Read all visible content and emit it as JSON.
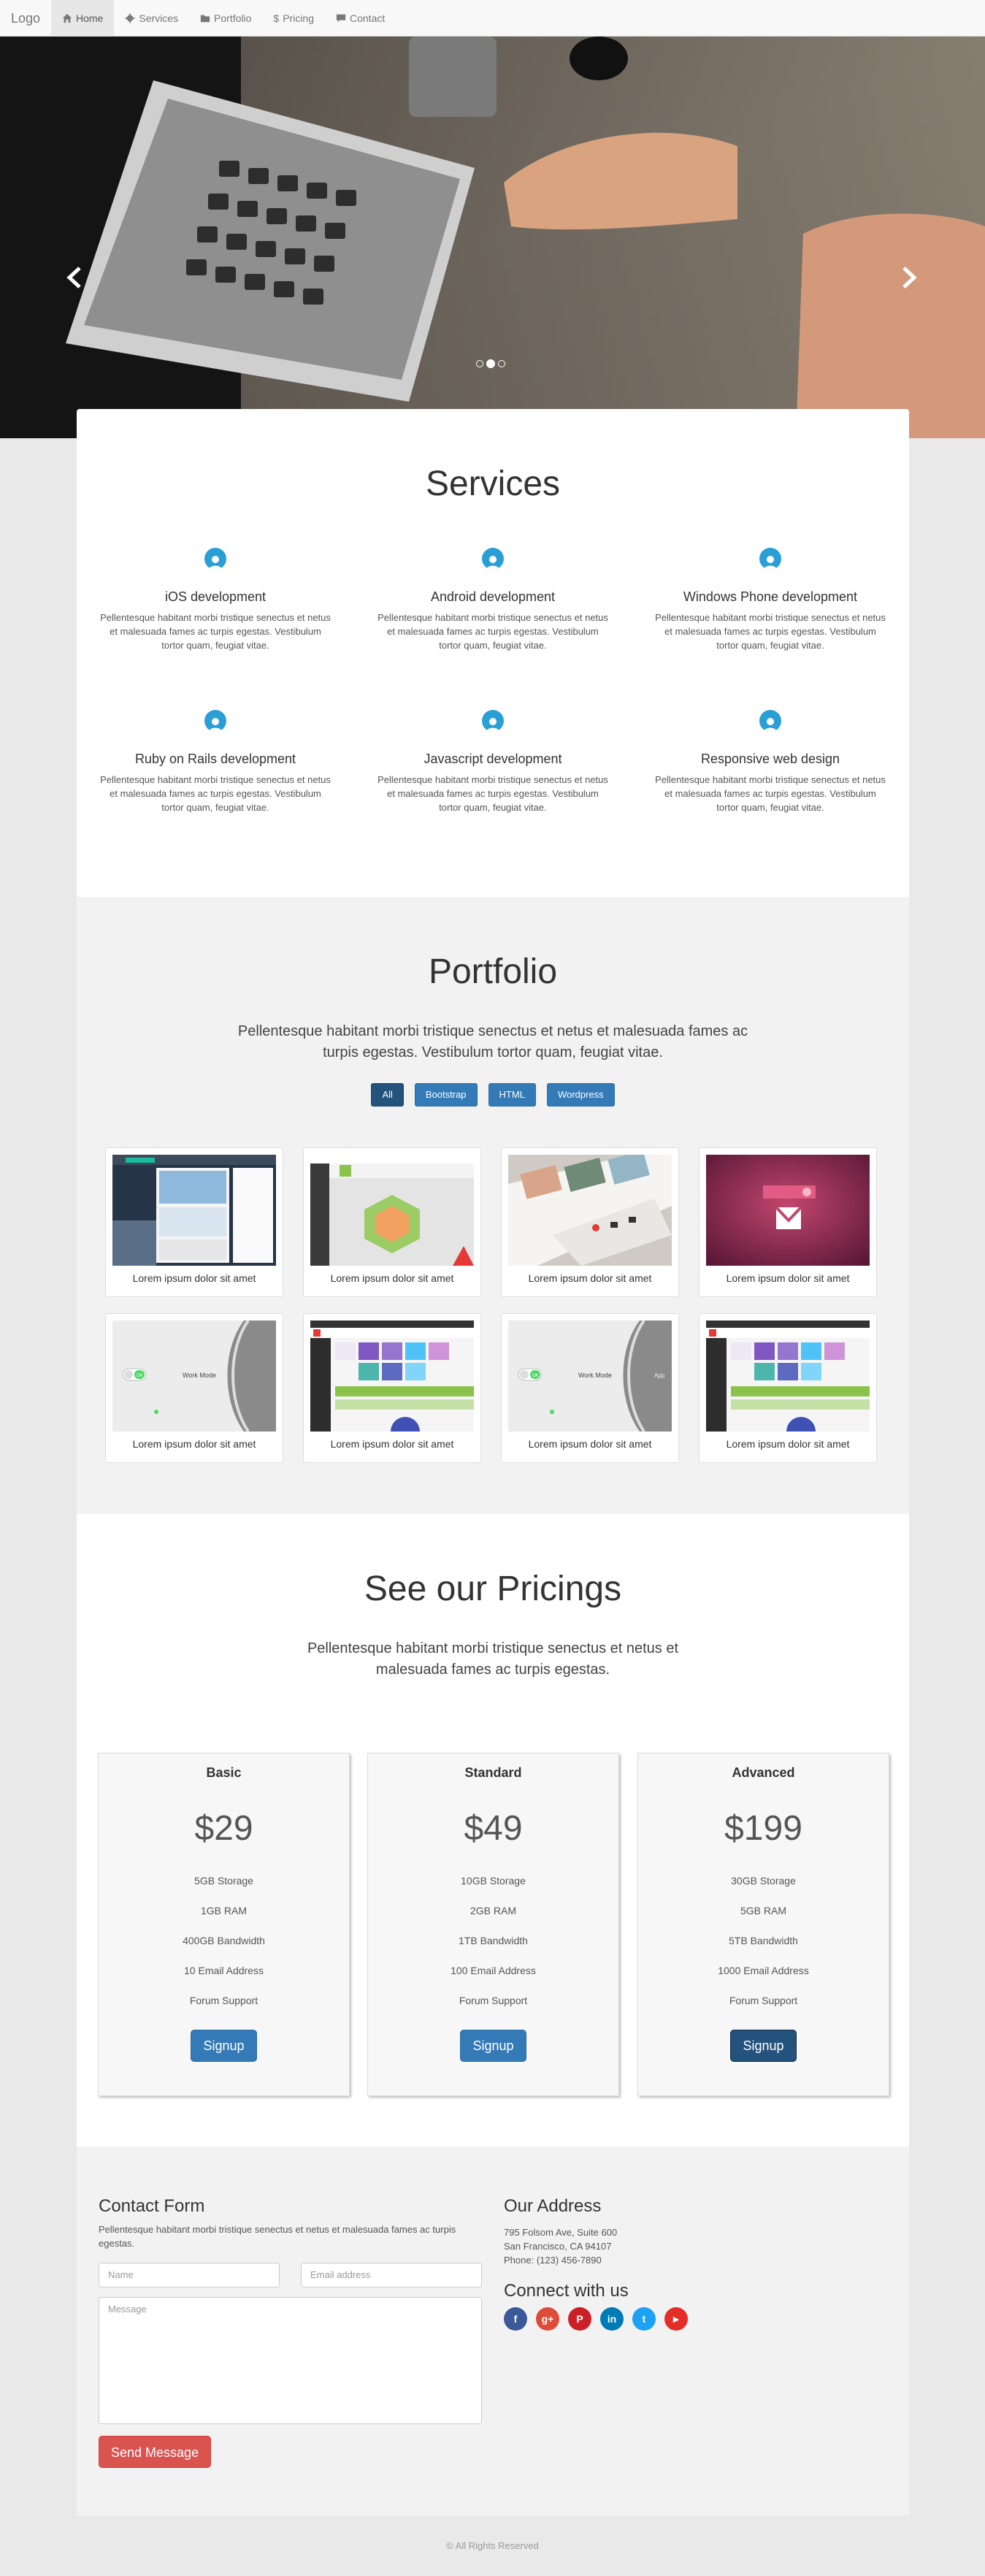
{
  "nav": {
    "logo": "Logo",
    "items": [
      {
        "label": "Home",
        "icon": "home-icon",
        "active": true
      },
      {
        "label": "Services",
        "icon": "gear-icon"
      },
      {
        "label": "Portfolio",
        "icon": "folder-icon"
      },
      {
        "label": "Pricing",
        "icon": "dollar-icon"
      },
      {
        "label": "Contact",
        "icon": "comment-icon"
      }
    ]
  },
  "carousel": {
    "slides": 3,
    "active_slide": 1
  },
  "services": {
    "title": "Services",
    "items": [
      {
        "title": "iOS development",
        "text": "Pellentesque habitant morbi tristique senectus et netus et malesuada fames ac turpis egestas. Vestibulum tortor quam, feugiat vitae."
      },
      {
        "title": "Android development",
        "text": "Pellentesque habitant morbi tristique senectus et netus et malesuada fames ac turpis egestas. Vestibulum tortor quam, feugiat vitae."
      },
      {
        "title": "Windows Phone development",
        "text": "Pellentesque habitant morbi tristique senectus et netus et malesuada fames ac turpis egestas. Vestibulum tortor quam, feugiat vitae."
      },
      {
        "title": "Ruby on Rails development",
        "text": "Pellentesque habitant morbi tristique senectus et netus et malesuada fames ac turpis egestas. Vestibulum tortor quam, feugiat vitae."
      },
      {
        "title": "Javascript development",
        "text": "Pellentesque habitant morbi tristique senectus et netus et malesuada fames ac turpis egestas. Vestibulum tortor quam, feugiat vitae."
      },
      {
        "title": "Responsive web design",
        "text": "Pellentesque habitant morbi tristique senectus et netus et malesuada fames ac turpis egestas. Vestibulum tortor quam, feugiat vitae."
      }
    ]
  },
  "portfolio": {
    "title": "Portfolio",
    "lead": "Pellentesque habitant morbi tristique senectus et netus et malesuada fames ac turpis egestas. Vestibulum tortor quam, feugiat vitae.",
    "filters": [
      "All",
      "Bootstrap",
      "HTML",
      "Wordpress"
    ],
    "active_filter": "All",
    "items": [
      {
        "caption": "Lorem ipsum dolor sit amet"
      },
      {
        "caption": "Lorem ipsum dolor sit amet"
      },
      {
        "caption": "Lorem ipsum dolor sit amet"
      },
      {
        "caption": "Lorem ipsum dolor sit amet"
      },
      {
        "caption": "Lorem ipsum dolor sit amet"
      },
      {
        "caption": "Lorem ipsum dolor sit amet"
      },
      {
        "caption": "Lorem ipsum dolor sit amet"
      },
      {
        "caption": "Lorem ipsum dolor sit amet"
      }
    ],
    "thumb_texts": {
      "ok_toggle": "OK",
      "work_mode": "Work Mode",
      "app": "App"
    }
  },
  "pricing": {
    "title": "See our Pricings",
    "lead": "Pellentesque habitant morbi tristique senectus et netus et malesuada fames ac turpis egestas.",
    "plans": [
      {
        "name": "Basic",
        "price": "$29",
        "features": [
          "5GB Storage",
          "1GB RAM",
          "400GB Bandwidth",
          "10 Email Address",
          "Forum Support"
        ],
        "button": "Signup"
      },
      {
        "name": "Standard",
        "price": "$49",
        "features": [
          "10GB Storage",
          "2GB RAM",
          "1TB Bandwidth",
          "100 Email Address",
          "Forum Support"
        ],
        "button": "Signup"
      },
      {
        "name": "Advanced",
        "price": "$199",
        "features": [
          "30GB Storage",
          "5GB RAM",
          "5TB Bandwidth",
          "1000 Email Address",
          "Forum Support"
        ],
        "button": "Signup"
      }
    ]
  },
  "contact": {
    "title": "Contact Form",
    "text": "Pellentesque habitant morbi tristique senectus et netus et malesuada fames ac turpis egestas.",
    "name_placeholder": "Name",
    "email_placeholder": "Email address",
    "message_placeholder": "Message",
    "send": "Send Message",
    "address_title": "Our Address",
    "address_lines": [
      "795 Folsom Ave, Suite 600",
      "San Francisco, CA 94107",
      "Phone: (123) 456-7890"
    ],
    "connect_title": "Connect with us",
    "social": [
      {
        "icon": "facebook-icon",
        "glyph": "f",
        "color": "#3b5998"
      },
      {
        "icon": "google-plus-icon",
        "glyph": "g+",
        "color": "#dd4b39"
      },
      {
        "icon": "pinterest-icon",
        "glyph": "P",
        "color": "#cb2027"
      },
      {
        "icon": "linkedin-icon",
        "glyph": "in",
        "color": "#007bb6"
      },
      {
        "icon": "twitter-icon",
        "glyph": "t",
        "color": "#1da1f2"
      },
      {
        "icon": "youtube-icon",
        "glyph": "▶",
        "color": "#e52d27"
      }
    ]
  },
  "footer": {
    "text": "© All Rights Reserved"
  },
  "colors": {
    "primary": "#337ab7",
    "accent_icon": "#2a9fd6",
    "danger": "#d9534f"
  }
}
